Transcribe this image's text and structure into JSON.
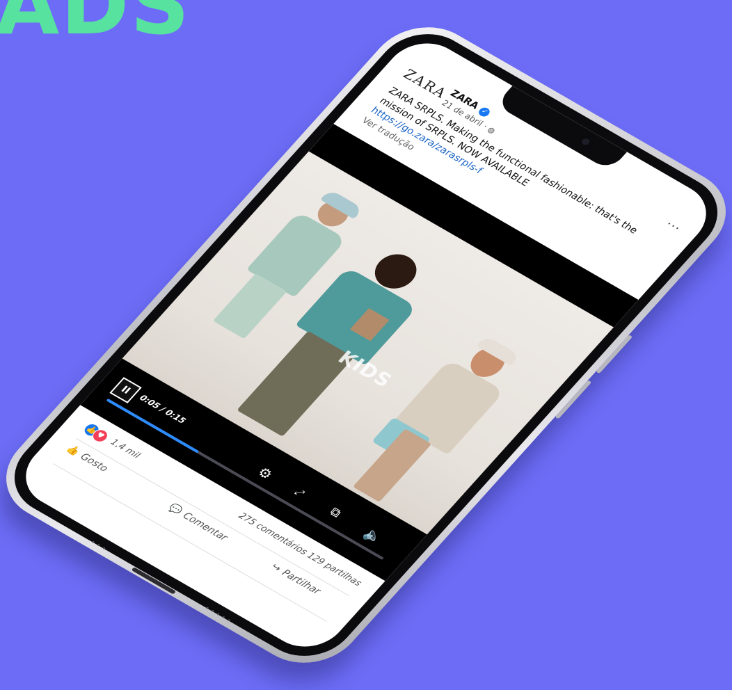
{
  "headline": "ADS",
  "post": {
    "brand_logo": "ZARA",
    "page_name": "ZARA",
    "date": "21 de abril ·",
    "caption": "ZARA SRPLS. Making the functional fashionable: that's the mission of SRPLS. NOW AVAILABLE",
    "link": "https://go.zara/zarasrpls-f",
    "see_translation": "Ver tradução",
    "more": "..."
  },
  "video": {
    "watermark": "KIDS",
    "timecode": "0:05 / 0:15",
    "progress": 0.33,
    "pause_glyph": "II"
  },
  "footer": {
    "reaction_count": "1,4 mil",
    "comments": "275 comentários",
    "shares": "129 partilhas",
    "like_label": "Gosto",
    "comment_label": "Comentar",
    "share_label": "Partilhar"
  },
  "icons": {
    "verified": "verified-badge-icon",
    "globe": "globe-icon",
    "settings": "gear-icon",
    "fullscreen": "expand-icon",
    "pip": "picture-in-picture-icon",
    "volume": "volume-icon"
  },
  "colors": {
    "background": "#6c6cf6",
    "headline": "#57e2a0",
    "link": "#1a63c7",
    "facebook_blue": "#1877f2",
    "love_red": "#f33e58"
  }
}
